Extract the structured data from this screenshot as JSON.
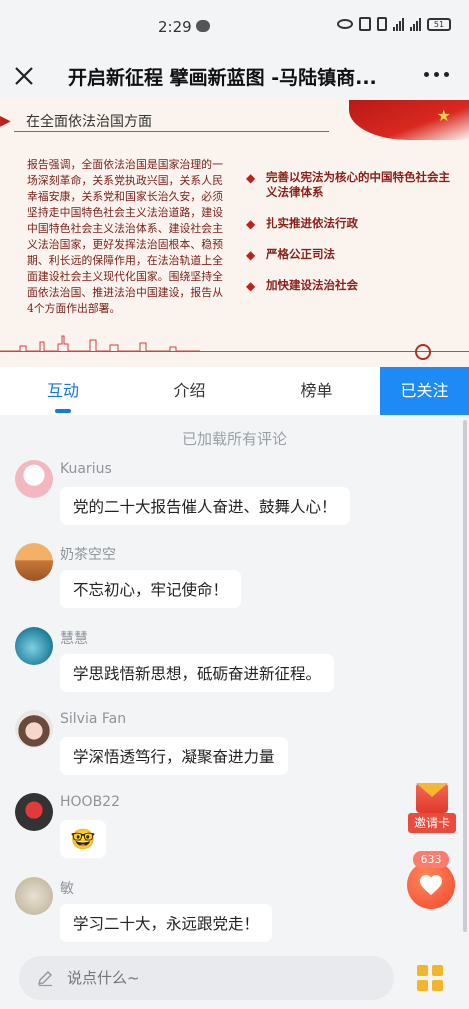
{
  "status_bar": {
    "time": "2:29",
    "battery": "51"
  },
  "header": {
    "title": "开启新征程 擘画新蓝图 -马陆镇商..."
  },
  "banner": {
    "heading": "在全面依法治国方面",
    "paragraph": "报告强调，全面依法治国是国家治理的一场深刻革命，关系党执政兴国，关系人民幸福安康，关系党和国家长治久安，必须坚持走中国特色社会主义法治道路，建设中国特色社会主义法治体系、建设社会主义法治国家，更好发挥法治固根本、稳预期、利长远的保障作用，在法治轨道上全面建设社会主义现代化国家。围绕坚持全面依法治国、推进法治中国建设，报告从4个方面作出部署。",
    "points": [
      "完善以宪法为核心的中国特色社会主义法律体系",
      "扎实推进依法行政",
      "严格公正司法",
      "加快建设法治社会"
    ]
  },
  "tabs": [
    {
      "label": "互动"
    },
    {
      "label": "介绍"
    },
    {
      "label": "榜单"
    },
    {
      "label": "已关注"
    }
  ],
  "comments_section": {
    "loaded_text": "已加载所有评论",
    "comments": [
      {
        "name": "Kuarius",
        "text": "党的二十大报告催人奋进、鼓舞人心！"
      },
      {
        "name": "奶茶空空",
        "text": "不忘初心，牢记使命！"
      },
      {
        "name": "慧慧",
        "text": "学思践悟新思想，砥砺奋进新征程。"
      },
      {
        "name": "Silvia Fan",
        "text": "学深悟透笃行，凝聚奋进力量"
      },
      {
        "name": "HOOB22",
        "text": "🤓"
      },
      {
        "name": "敏",
        "text": "学习二十大，永远跟党走！"
      }
    ]
  },
  "floating": {
    "invite_label": "邀请卡",
    "like_count": "633"
  },
  "input": {
    "placeholder": "说点什么~"
  },
  "colors": {
    "accent": "#1677e6",
    "follow_bg": "#1d8af5",
    "banner_red": "#c0201c"
  }
}
